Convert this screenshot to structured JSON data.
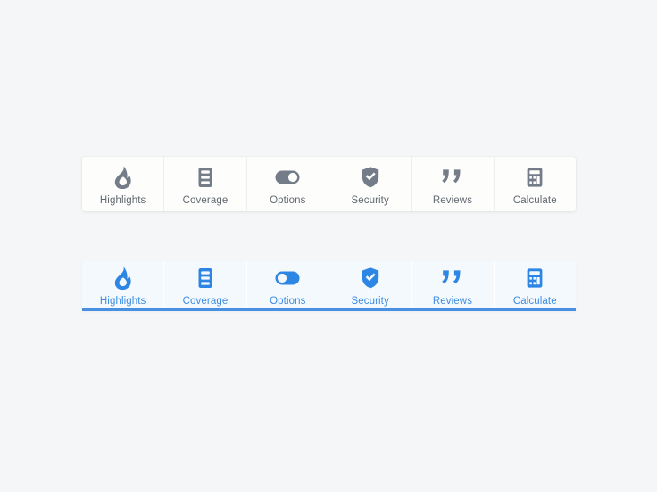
{
  "page": {
    "background_color": "#f5f6f7"
  },
  "theme": {
    "inactive_icon_color": "#747c89",
    "inactive_label_color": "#616871",
    "inactive_card_bg": "#fdfdfc",
    "inactive_divider_color": "#eceef0",
    "active_icon_color": "#2e86e4",
    "active_label_color": "#3c8ce0",
    "active_card_bg": "#f4f9fe",
    "active_divider_color": "#ffffff",
    "active_underline_color": "#4a90e2"
  },
  "tabbars": [
    {
      "name": "inactive-tabbar",
      "state": "inactive",
      "tabs": [
        {
          "label": "Highlights",
          "icon": "flame-icon"
        },
        {
          "label": "Coverage",
          "icon": "list-document-icon"
        },
        {
          "label": "Options",
          "icon": "toggle-switch-off-icon"
        },
        {
          "label": "Security",
          "icon": "shield-check-icon"
        },
        {
          "label": "Reviews",
          "icon": "quote-marks-icon"
        },
        {
          "label": "Calculate",
          "icon": "calculator-icon"
        }
      ]
    },
    {
      "name": "active-tabbar",
      "state": "active",
      "tabs": [
        {
          "label": "Highlights",
          "icon": "flame-icon"
        },
        {
          "label": "Coverage",
          "icon": "list-document-icon"
        },
        {
          "label": "Options",
          "icon": "toggle-switch-on-icon"
        },
        {
          "label": "Security",
          "icon": "shield-check-icon"
        },
        {
          "label": "Reviews",
          "icon": "quote-marks-icon"
        },
        {
          "label": "Calculate",
          "icon": "calculator-icon"
        }
      ]
    }
  ]
}
